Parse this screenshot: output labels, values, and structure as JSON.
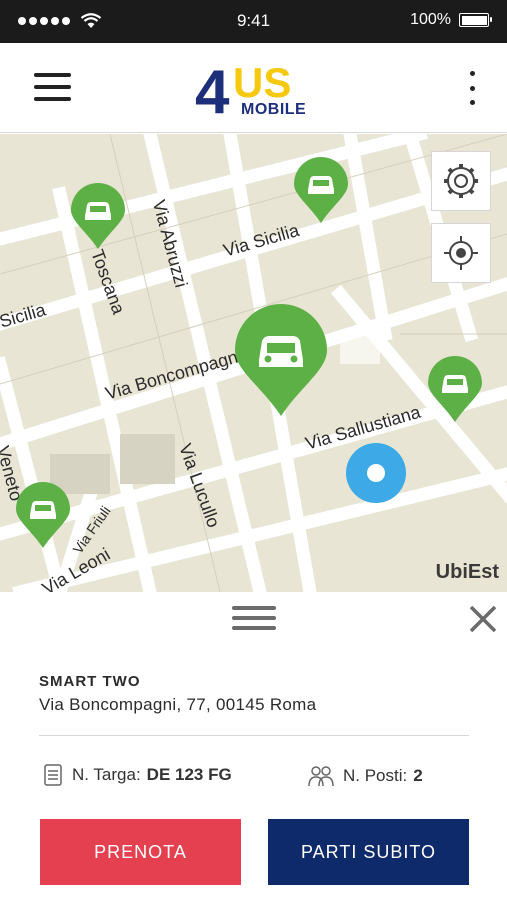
{
  "status_bar": {
    "time": "9:41",
    "battery": "100%"
  },
  "header": {
    "logo_main": "4US",
    "logo_sub": "MOBILE",
    "menu_icon": "hamburger-icon",
    "more_icon": "kebab-menu-icon"
  },
  "map": {
    "streets": [
      "Via Sicilia",
      "Sicilia",
      "Via Boncompagni",
      "Via Sallustiana",
      "Via Lucullo",
      "Via Abruzzi",
      "Toscana",
      "Via Friuli",
      "Via Leoni",
      "Veneto"
    ],
    "watermark": "UbiEst",
    "settings_icon": "gear-icon",
    "locate_icon": "crosshair-icon"
  },
  "sheet": {
    "car_name": "SMART TWO",
    "address": "Via Boncompagni, 77, 00145 Roma",
    "plate_label": "N. Targa:",
    "plate_value": "DE 123 FG",
    "seats_label": "N. Posti:",
    "seats_value": "2",
    "book_label": "PRENOTA",
    "start_label": "PARTI SUBITO"
  },
  "colors": {
    "pin_green": "#5cb046",
    "location_blue": "#3da9e6",
    "book_red": "#e5404f",
    "start_navy": "#0f2a6b",
    "logo_navy": "#1d2f7a",
    "logo_yellow": "#f6c90e"
  }
}
